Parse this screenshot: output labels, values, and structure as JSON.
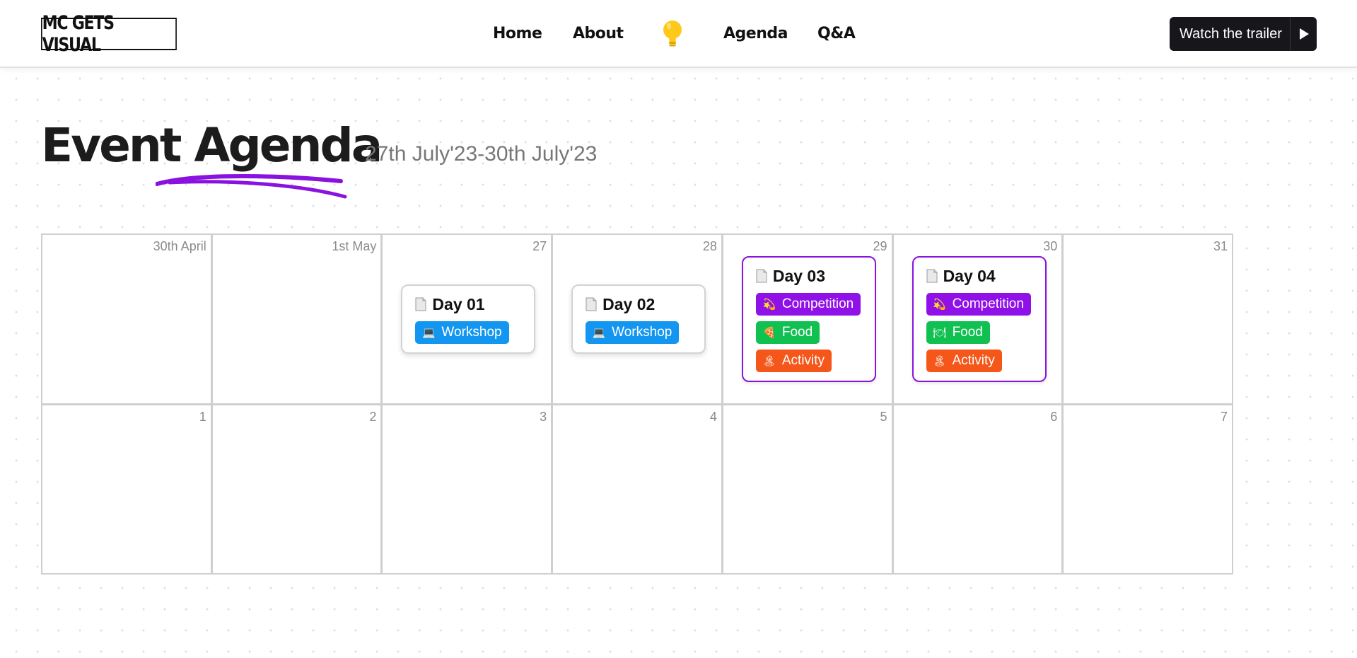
{
  "header": {
    "logo": "MC GETS VISUAL",
    "nav": [
      {
        "label": "Home"
      },
      {
        "label": "About"
      },
      {
        "label": "Agenda"
      },
      {
        "label": "Q&A"
      }
    ],
    "bulb_icon": "lightbulb-icon",
    "trailer_button": "Watch the trailer",
    "trailer_icon": "play-icon"
  },
  "page": {
    "title": "Event Agenda",
    "subtitle": "27th July'23-30th July'23",
    "accent_color": "#8a12e0"
  },
  "calendar": {
    "row1": [
      "30th April",
      "1st May",
      "27",
      "28",
      "29",
      "30",
      "31"
    ],
    "row2": [
      "1",
      "2",
      "3",
      "4",
      "5",
      "6",
      "7"
    ]
  },
  "events": {
    "day01": {
      "title": "Day 01",
      "tags": [
        {
          "label": "Workshop",
          "icon": "laptop-icon",
          "color": "#1296f0"
        }
      ]
    },
    "day02": {
      "title": "Day 02",
      "tags": [
        {
          "label": "Workshop",
          "icon": "laptop-icon",
          "color": "#1296f0"
        }
      ]
    },
    "day03": {
      "title": "Day 03",
      "tags": [
        {
          "label": "Competition",
          "icon": "dizzy-icon",
          "color": "#9010e8"
        },
        {
          "label": "Food",
          "icon": "pizza-icon",
          "color": "#10c050"
        },
        {
          "label": "Activity",
          "icon": "island-icon",
          "color": "#f5561a"
        }
      ]
    },
    "day04": {
      "title": "Day 04",
      "tags": [
        {
          "label": "Competition",
          "icon": "dizzy-icon",
          "color": "#9010e8"
        },
        {
          "label": "Food",
          "icon": "food-icon",
          "color": "#10c050"
        },
        {
          "label": "Activity",
          "icon": "island-icon",
          "color": "#f5561a"
        }
      ]
    }
  }
}
